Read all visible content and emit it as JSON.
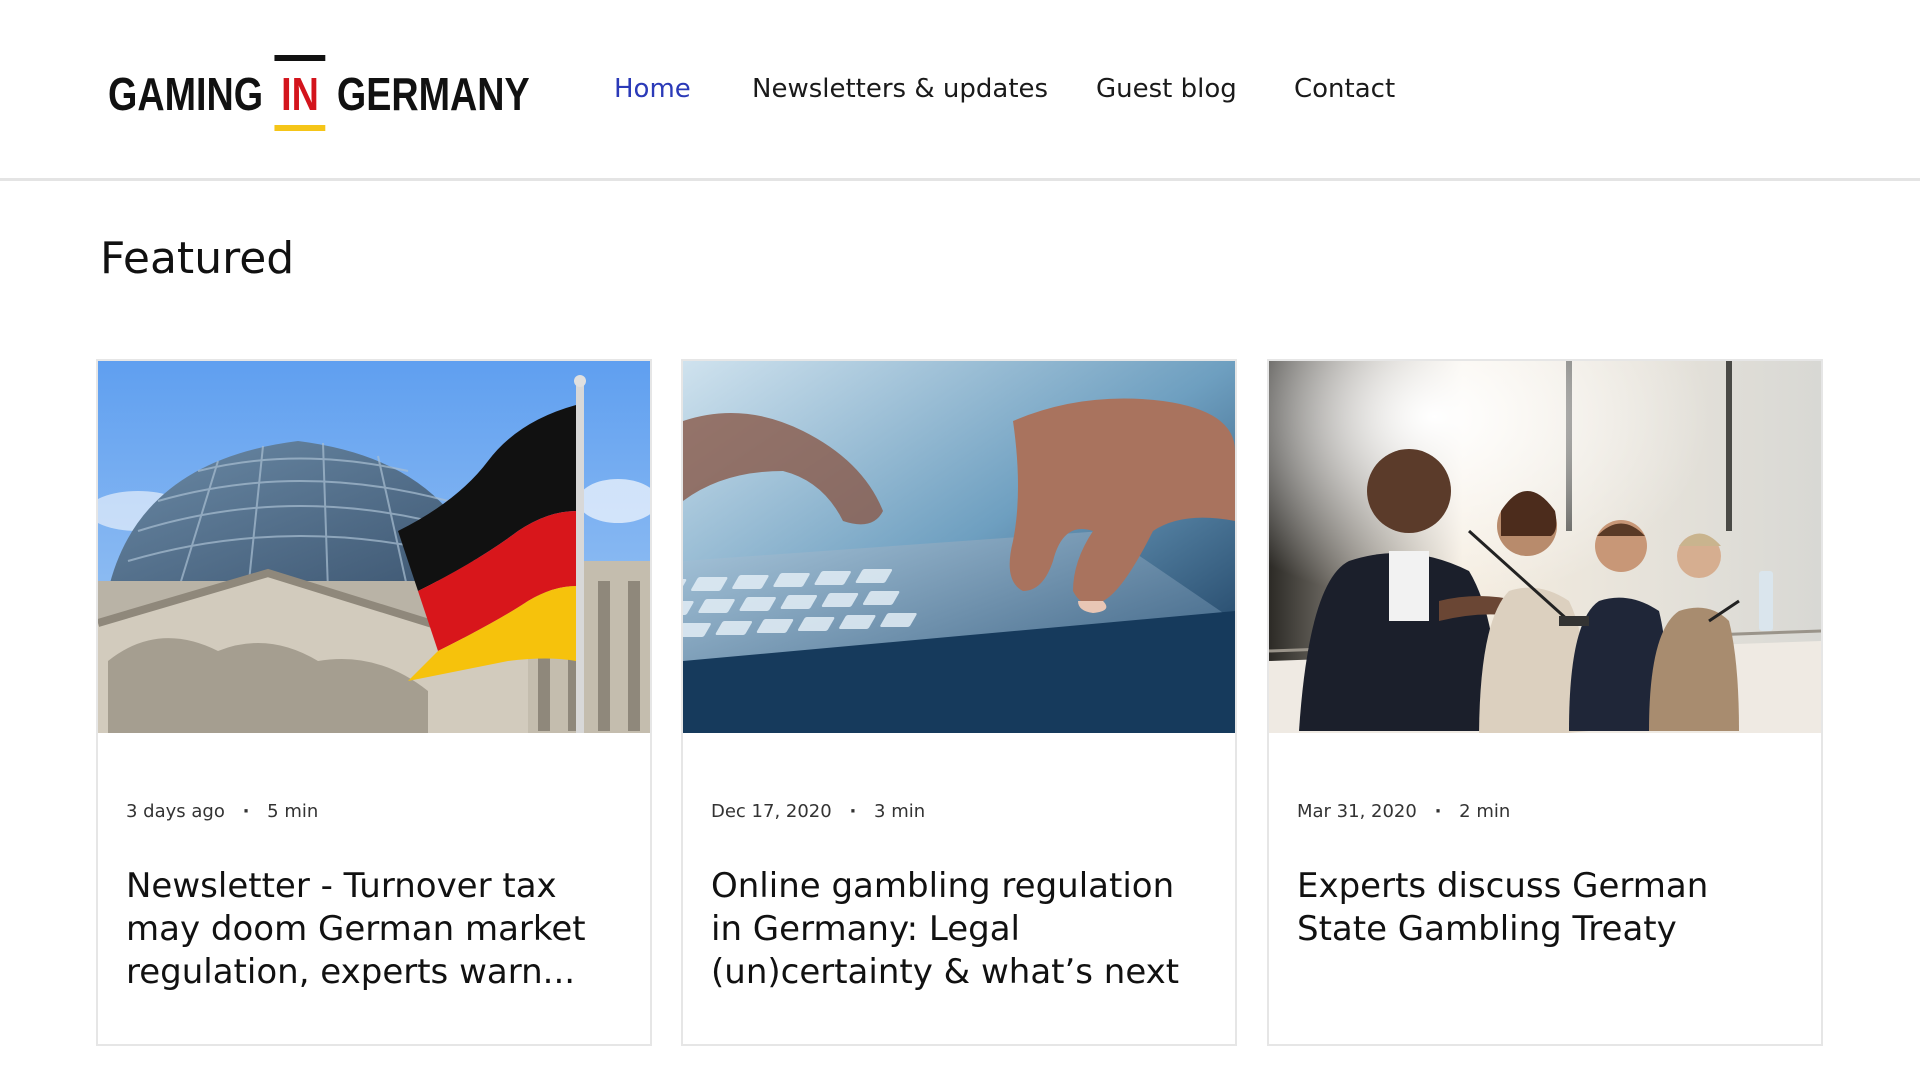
{
  "logo": {
    "word1": "GAMING",
    "word2": "IN",
    "word3": "GERMANY"
  },
  "nav": {
    "items": [
      {
        "label": "Home",
        "active": true
      },
      {
        "label": "Newsletters & updates",
        "active": false
      },
      {
        "label": "Guest blog",
        "active": false
      },
      {
        "label": "Contact",
        "active": false
      }
    ]
  },
  "featured": {
    "heading": "Featured",
    "posts": [
      {
        "date": "3 days ago",
        "read_time": "5 min",
        "title": "Newsletter - Turnover tax may doom German market regulation, experts warn...",
        "image": "reichstag-german-flag-photo"
      },
      {
        "date": "Dec 17, 2020",
        "read_time": "3 min",
        "title": "Online gambling regulation in Germany: Legal (un)certainty & what’s next",
        "image": "hands-typing-laptop-photo"
      },
      {
        "date": "Mar 31, 2020",
        "read_time": "2 min",
        "title": "Experts discuss German State Gambling Treaty",
        "image": "conference-panel-photo"
      }
    ]
  },
  "colors": {
    "nav_active": "#2b3ab8",
    "logo_in_red": "#d3141c",
    "logo_gold": "#f5c518",
    "card_border": "#e6e6e6"
  }
}
